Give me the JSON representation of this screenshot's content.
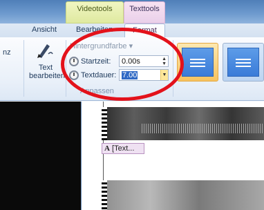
{
  "context_tabs": {
    "video": "Videotools",
    "text": "Texttools"
  },
  "tabs": [
    "Ansicht",
    "Bearbeiten",
    "Format"
  ],
  "left_group_label": "nz",
  "edit_text_button": "Text bearbeiten",
  "background_color": "Hintergrundfarbe",
  "fields": {
    "start_time": {
      "label": "Startzeit:",
      "value": "0.00s"
    },
    "text_duration": {
      "label": "Textdauer:",
      "value": "7.00"
    }
  },
  "group_label": "Anpassen",
  "timeline": {
    "text_clip": "[Text..."
  },
  "colors": {
    "annotation_circle": "#e3121b",
    "texttools_tab": "#ead0ea",
    "videotools_tab": "#dfe9a0"
  }
}
